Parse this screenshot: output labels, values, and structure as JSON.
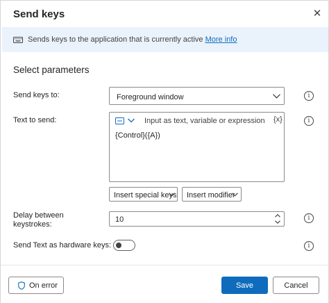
{
  "dialog": {
    "title": "Send keys",
    "close_glyph": "✕"
  },
  "banner": {
    "icon": "keyboard-icon",
    "text": "Sends keys to the application that is currently active",
    "link": "More info"
  },
  "section_title": "Select parameters",
  "fields": {
    "send_keys_to": {
      "label": "Send keys to:",
      "value": "Foreground window"
    },
    "text_to_send": {
      "label": "Text to send:",
      "mode_label": "Input as text, variable or expression",
      "variable_glyph": "{x}",
      "value": "{Control}({A})"
    },
    "insert_special_keys": "Insert special keys",
    "insert_modifier": "Insert modifier",
    "delay": {
      "label_line1": "Delay between",
      "label_line2": "keystrokes:",
      "value": "10"
    },
    "hardware_keys": {
      "label": "Send Text as hardware keys:",
      "enabled": false
    }
  },
  "info_glyph": "i",
  "footer": {
    "on_error": "On error",
    "save": "Save",
    "cancel": "Cancel"
  },
  "colors": {
    "accent": "#0f6cbd",
    "banner_bg": "#eaf2fb"
  }
}
